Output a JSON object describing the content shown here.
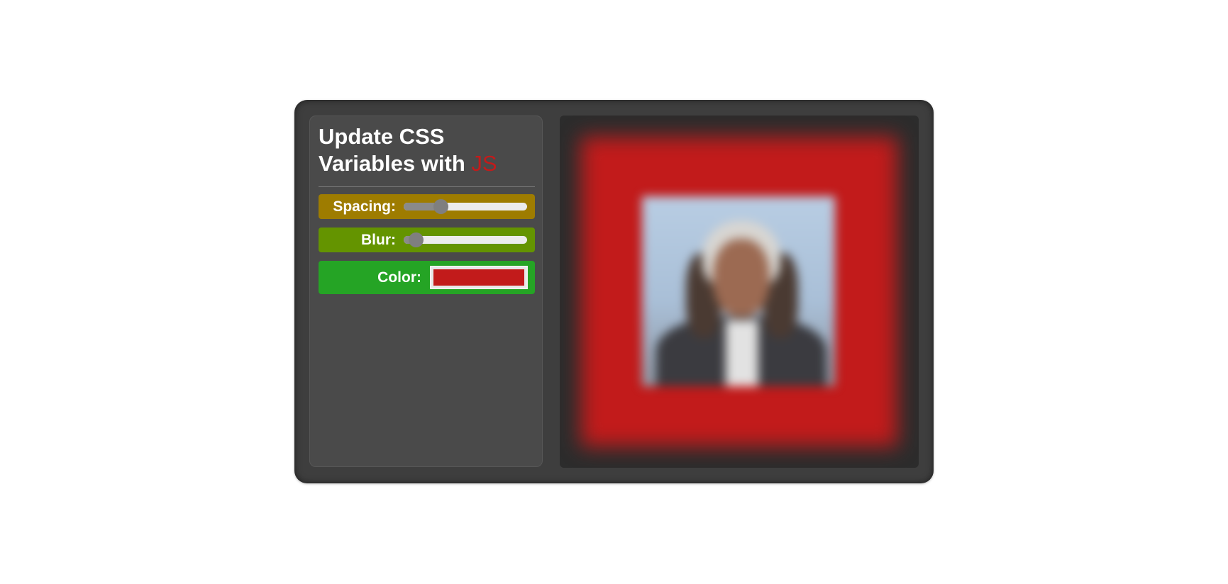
{
  "panel": {
    "title_main": "Update CSS Variables with",
    "title_accent": "JS",
    "accent_color": "#c21b1b"
  },
  "controls": {
    "spacing": {
      "label": "Spacing:",
      "value_fraction": 0.3,
      "row_color": "#9e7c00"
    },
    "blur": {
      "label": "Blur:",
      "value_fraction": 0.1,
      "row_color": "#649400"
    },
    "color": {
      "label": "Color:",
      "value": "#c21b1b",
      "row_color": "#25a425"
    }
  },
  "preview": {
    "background_color": "#c21b1b",
    "image_icon": "portrait-photo"
  }
}
